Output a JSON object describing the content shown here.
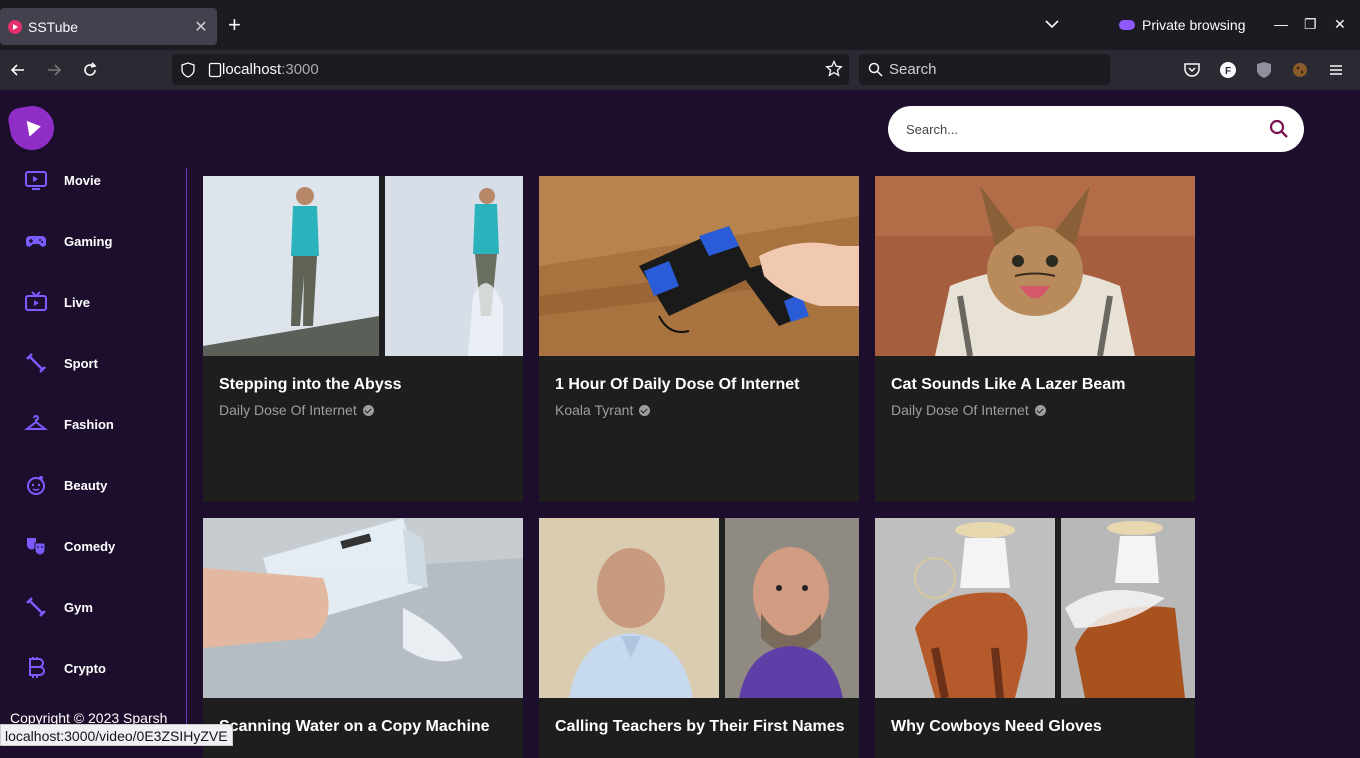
{
  "browser": {
    "tab_title": "SSTube",
    "tab_close": "✕",
    "new_tab": "+",
    "private_label": "Private browsing",
    "url_host": "localhost",
    "url_port": ":3000",
    "search_placeholder": "Search",
    "status_url": "localhost:3000/video/0E3ZSIHyZVE"
  },
  "app": {
    "search_placeholder": "Search...",
    "copyright": "Copyright © 2023 Sparsh"
  },
  "sidebar": {
    "items": [
      {
        "label": "Movie",
        "icon": "tv-icon"
      },
      {
        "label": "Gaming",
        "icon": "gamepad-icon"
      },
      {
        "label": "Live",
        "icon": "live-tv-icon"
      },
      {
        "label": "Sport",
        "icon": "fitness-icon"
      },
      {
        "label": "Fashion",
        "icon": "hanger-icon"
      },
      {
        "label": "Beauty",
        "icon": "face-icon"
      },
      {
        "label": "Comedy",
        "icon": "theater-masks-icon"
      },
      {
        "label": "Gym",
        "icon": "dumbbell-icon"
      },
      {
        "label": "Crypto",
        "icon": "bitcoin-icon"
      }
    ]
  },
  "videos": [
    {
      "title": "Stepping into the Abyss",
      "channel": "Daily Dose Of Internet"
    },
    {
      "title": "1 Hour Of Daily Dose Of Internet",
      "channel": "Koala Tyrant"
    },
    {
      "title": "Cat Sounds Like A Lazer Beam",
      "channel": "Daily Dose Of Internet"
    },
    {
      "title": "Scanning Water on a Copy Machine",
      "channel": ""
    },
    {
      "title": "Calling Teachers by Their First Names",
      "channel": ""
    },
    {
      "title": "Why Cowboys Need Gloves",
      "channel": ""
    }
  ],
  "colors": {
    "accent": "#8e2ec7",
    "sidebar_icon": "#7b5cff",
    "app_bg": "#1c0e2c",
    "card_bg": "#1e1e1e"
  }
}
